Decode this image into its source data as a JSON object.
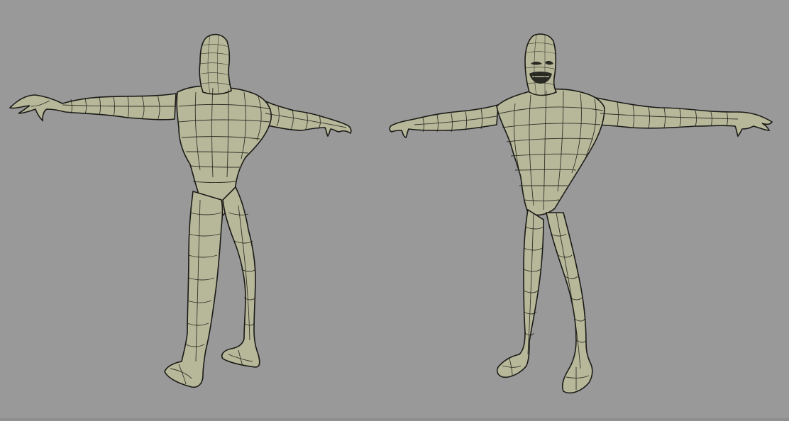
{
  "scene": {
    "background_color": "#999999",
    "mesh_color": "#b7b89a",
    "wireframe_color": "#22231c",
    "objects": [
      {
        "id": "back",
        "icon": "character-mesh-back-view"
      },
      {
        "id": "front",
        "icon": "character-mesh-front-view"
      }
    ]
  }
}
